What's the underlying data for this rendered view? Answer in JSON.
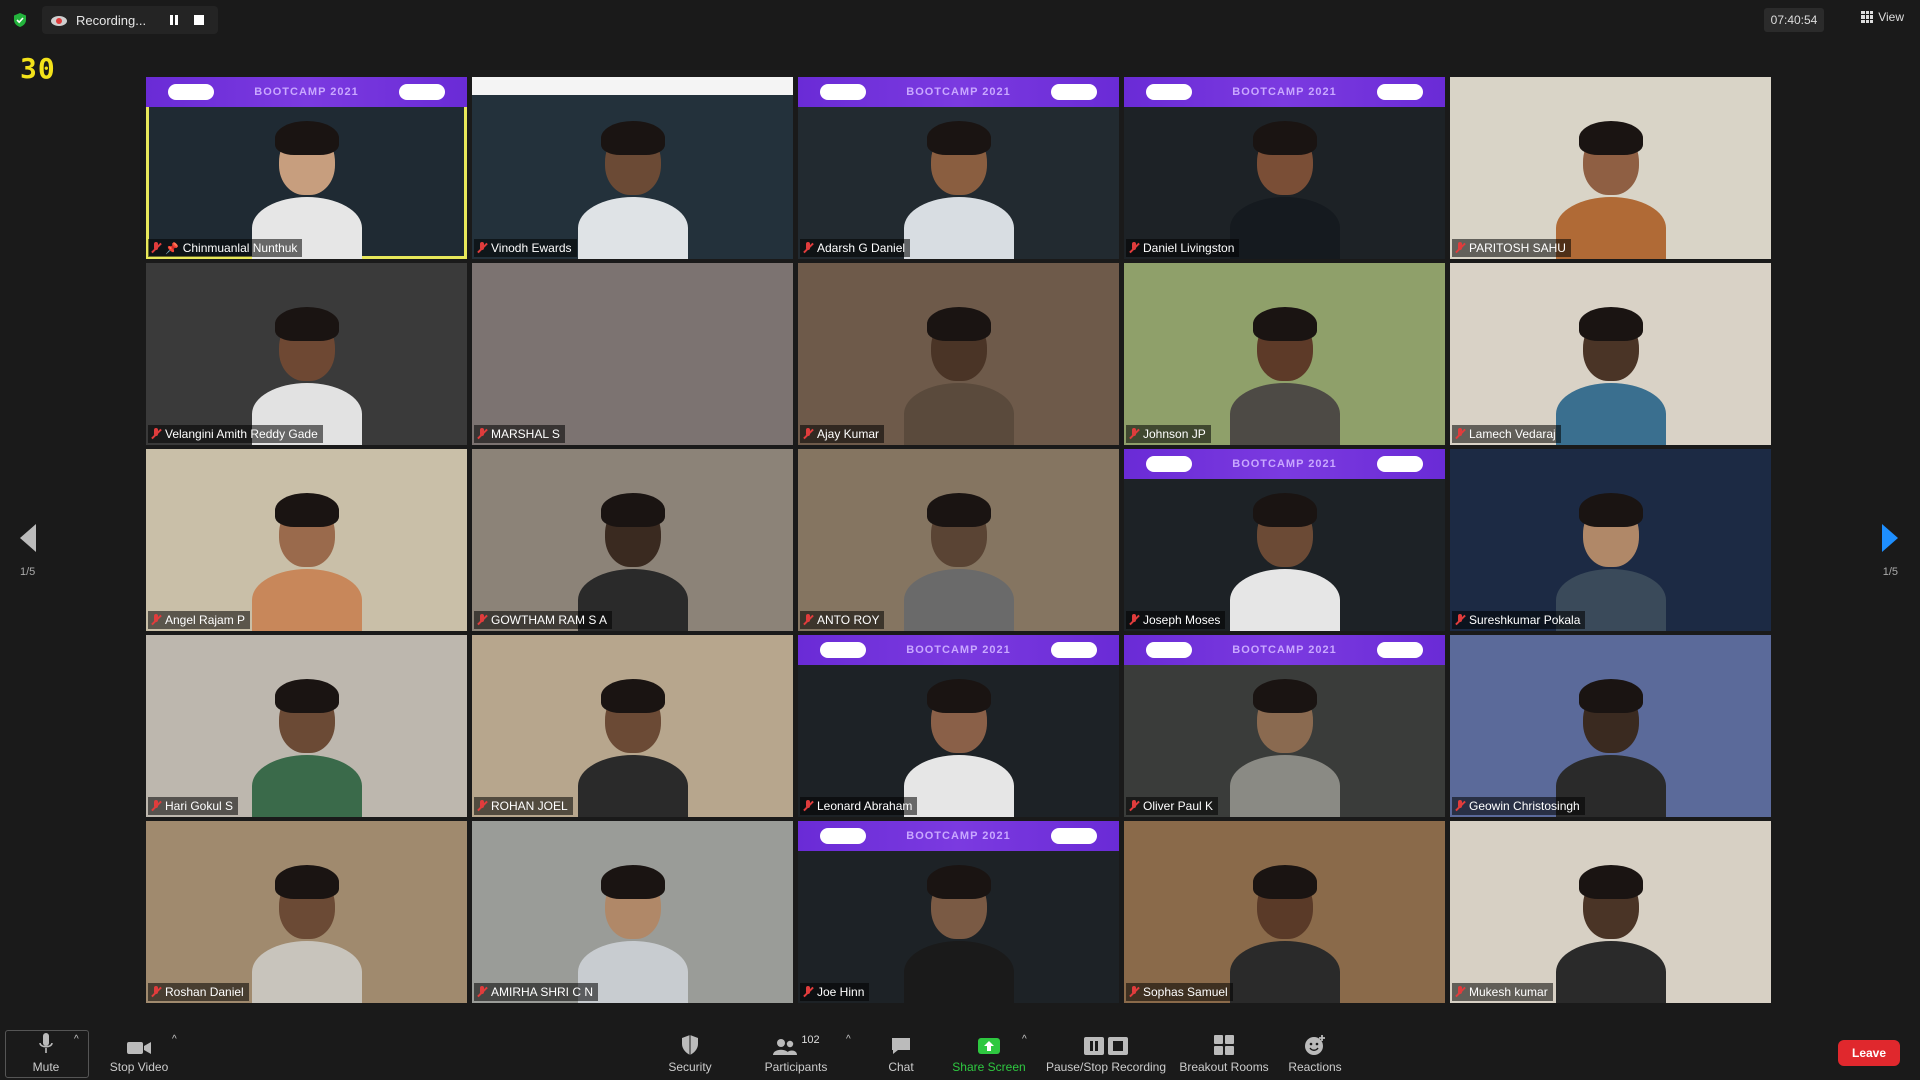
{
  "recording": {
    "label": "Recording..."
  },
  "clock": "07:40:54",
  "view": {
    "label": "View"
  },
  "counter": "30",
  "page_indicator": "1/5",
  "participants": [
    {
      "name": "Chinmuanlal Nunthuk",
      "active": true,
      "pinned": true,
      "banner": "purple",
      "banner_text": "BOOTCAMP 2021",
      "bg": "#1f2a33",
      "skin": "#c79e7e",
      "shirt": "#e6e6e6"
    },
    {
      "name": "Vinodh Ewards",
      "banner": "white",
      "bg": "#23313b",
      "skin": "#6b4a35",
      "shirt": "#dfe3e6"
    },
    {
      "name": "Adarsh G Daniel",
      "banner": "purple",
      "banner_text": "BOOTCAMP 2021",
      "bg": "#222a30",
      "skin": "#8a5e40",
      "shirt": "#d8dde2"
    },
    {
      "name": "Daniel Livingston",
      "banner": "purple",
      "banner_text": "BOOTCAMP 2021",
      "bg": "#1d2226",
      "skin": "#7a4e36",
      "shirt": "#151a1f"
    },
    {
      "name": "PARITOSH SAHU",
      "bg": "#d9d4c7",
      "skin": "#8f5f43",
      "shirt": "#b06a36"
    },
    {
      "name": "Velangini Amith Reddy Gade",
      "bg": "#3a3a3a",
      "skin": "#6e4833",
      "shirt": "#e2e2e2"
    },
    {
      "name": "MARSHAL S",
      "bg": "#7c7371",
      "skin": "#7c7371",
      "shirt": "#7c7371",
      "no_video_person": true
    },
    {
      "name": "Ajay Kumar",
      "bg": "#6e5a4a",
      "skin": "#4a3426",
      "shirt": "#5a4a3c"
    },
    {
      "name": "Johnson JP",
      "bg": "#8fa06a",
      "skin": "#5d3a28",
      "shirt": "#4d4a45"
    },
    {
      "name": "Lamech Vedaraj",
      "bg": "#d9d2c6",
      "skin": "#4a3426",
      "shirt": "#3a6f8f"
    },
    {
      "name": "Angel Rajam P",
      "bg": "#c9bfa8",
      "skin": "#9a6a4c",
      "shirt": "#c8875a"
    },
    {
      "name": "GOWTHAM RAM S A",
      "bg": "#8c8378",
      "skin": "#3a2a20",
      "shirt": "#2a2a2a"
    },
    {
      "name": "ANTO ROY",
      "bg": "#857561",
      "skin": "#5a4434",
      "shirt": "#6a6a6a"
    },
    {
      "name": "Joseph Moses",
      "banner": "purple",
      "banner_text": "BOOTCAMP 2021",
      "bg": "#1d2226",
      "skin": "#6b4a35",
      "shirt": "#e6e6e6"
    },
    {
      "name": "Sureshkumar Pokala",
      "bg": "#1c2a44",
      "skin": "#b08868",
      "shirt": "#3a4a5a"
    },
    {
      "name": "Hari Gokul S",
      "bg": "#bdb7ae",
      "skin": "#6b4a35",
      "shirt": "#3a6a4a"
    },
    {
      "name": "ROHAN JOEL",
      "bg": "#b7a68d",
      "skin": "#6b4a35",
      "shirt": "#2a2a2a"
    },
    {
      "name": "Leonard Abraham",
      "banner": "purple",
      "banner_text": "BOOTCAMP 2021",
      "bg": "#1d2226",
      "skin": "#8a6048",
      "shirt": "#e6e6e6"
    },
    {
      "name": "Oliver Paul K",
      "banner": "purple",
      "banner_text": "BOOTCAMP 2021",
      "bg": "#3a3c3a",
      "skin": "#8a6a50",
      "shirt": "#8a8a84"
    },
    {
      "name": "Geowin Christosingh",
      "bg": "#5b6a9a",
      "skin": "#3a2a20",
      "shirt": "#2a2a2a"
    },
    {
      "name": "Roshan Daniel",
      "bg": "#a08a6e",
      "skin": "#6b4a35",
      "shirt": "#c8c4bc"
    },
    {
      "name": "AMIRHA SHRI C N",
      "bg": "#9a9c98",
      "skin": "#b08868",
      "shirt": "#c8ccd0"
    },
    {
      "name": "Joe Hinn",
      "banner": "purple",
      "banner_text": "BOOTCAMP 2021",
      "bg": "#1d2226",
      "skin": "#7a5a44",
      "shirt": "#1a1a1a"
    },
    {
      "name": "Sophas Samuel",
      "bg": "#8a6a4a",
      "skin": "#5a3a28",
      "shirt": "#2a2a2a"
    },
    {
      "name": "Mukesh kumar",
      "bg": "#d7d0c4",
      "skin": "#4a3426",
      "shirt": "#2a2a2a"
    }
  ],
  "toolbar": {
    "mute": "Mute",
    "stop_video": "Stop Video",
    "security": "Security",
    "participants": "Participants",
    "participants_count": "102",
    "chat": "Chat",
    "share_screen": "Share Screen",
    "pause_stop_recording": "Pause/Stop Recording",
    "breakout_rooms": "Breakout Rooms",
    "reactions": "Reactions",
    "leave": "Leave"
  },
  "colors": {
    "accent_green": "#2ec840",
    "leave_red": "#e0282d",
    "active_border": "#e8e85a",
    "counter_yellow": "#f3e21a"
  }
}
